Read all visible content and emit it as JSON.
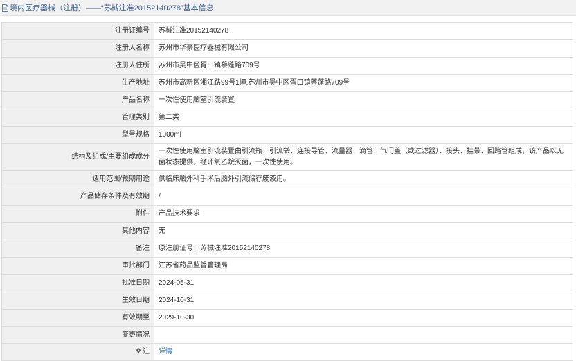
{
  "header": {
    "title": "境内医疗器械（注册）——“苏械注准20152140278”基本信息"
  },
  "rows": [
    {
      "label": "注册证编号",
      "value": "苏械注准20152140278"
    },
    {
      "label": "注册人名称",
      "value": "苏州市华豪医疗器械有限公司"
    },
    {
      "label": "注册人住所",
      "value": "苏州市吴中区胥口镇蔡蓬路709号"
    },
    {
      "label": "生产地址",
      "value": "苏州市高新区湘江路99号1幢,苏州市吴中区胥口镇蔡蓬路709号"
    },
    {
      "label": "产品名称",
      "value": "一次性使用脑室引流装置"
    },
    {
      "label": "管理类别",
      "value": "第二类"
    },
    {
      "label": "型号规格",
      "value": "1000ml"
    },
    {
      "label": "结构及组成/主要组成成分",
      "value": "一次性使用脑室引流装置由引流瓶、引流袋、连接导管、流量器、滴管、气门盖（或过滤器）、接头、挂带、回路管组成，该产品以无菌状态提供，经环氧乙烷灭菌，一次性使用。"
    },
    {
      "label": "适用范围/预期用途",
      "value": "供临床脑外科手术后脑外引流储存废液用。"
    },
    {
      "label": "产品储存条件及有效期",
      "value": "/"
    },
    {
      "label": "附件",
      "value": "产品技术要求"
    },
    {
      "label": "其他内容",
      "value": "无"
    },
    {
      "label": "备注",
      "value": "原注册证号：苏械注准20152140278"
    },
    {
      "label": "审批部门",
      "value": "江苏省药品监督管理局"
    },
    {
      "label": "批准日期",
      "value": "2024-05-31"
    },
    {
      "label": "生效日期",
      "value": "2024-10-31"
    },
    {
      "label": "有效期至",
      "value": "2029-10-30"
    },
    {
      "label": "变更情况",
      "value": ""
    }
  ],
  "note_row": {
    "label": "注",
    "link_text": "详情",
    "icon": "pin-icon"
  },
  "colors": {
    "title_text": "#3a5f8f",
    "label_bg": "#f0f0f0",
    "border": "#dcdcdc",
    "link": "#2a6fbf"
  }
}
